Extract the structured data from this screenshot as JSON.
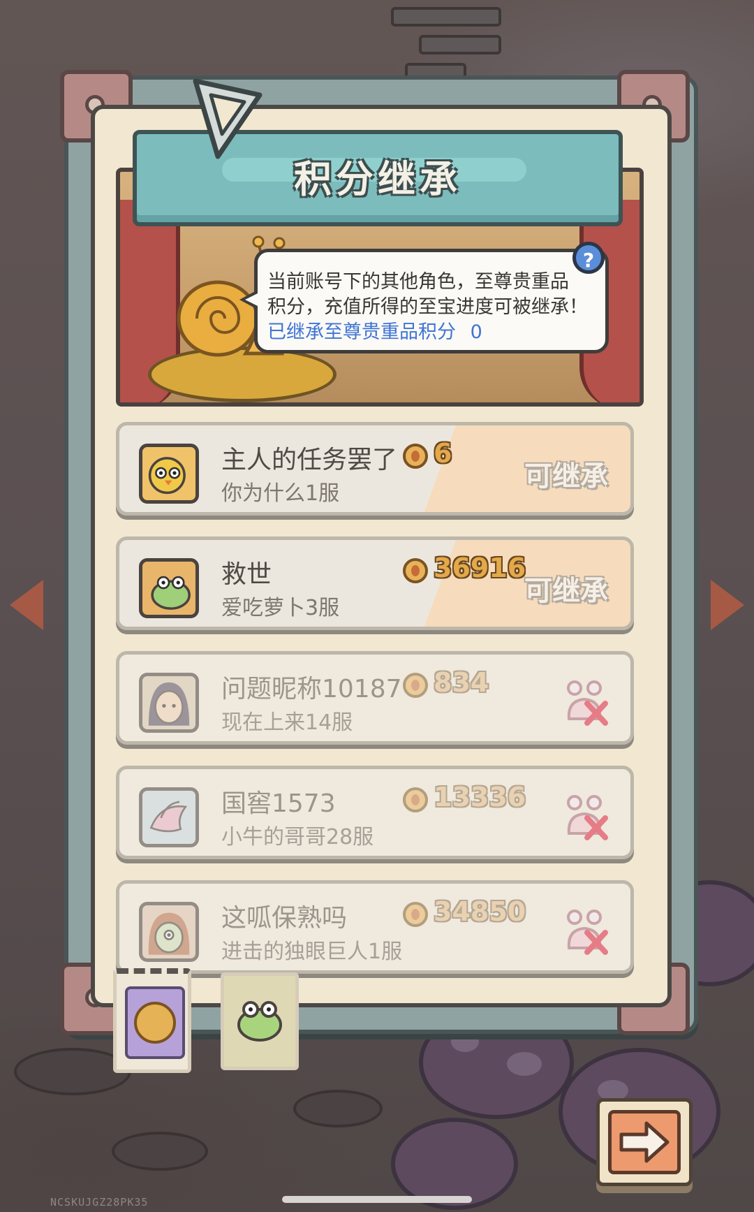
{
  "title": "积分继承",
  "info": {
    "line1": "当前账号下的其他角色，至尊贵重品",
    "line2": "积分，充值所得的至宝进度可被继承！",
    "inherited_label": "已继承至尊贵重品积分",
    "inherited_value": "0",
    "help_glyph": "?"
  },
  "characters": [
    {
      "name": "主人的任务罢了",
      "server": "你为什么1服",
      "score": "6",
      "status": "可继承",
      "inheritable": true,
      "avatar_icon": "chick-icon"
    },
    {
      "name": "救世",
      "server": "爱吃萝卜3服",
      "score": "36916",
      "status": "可继承",
      "inheritable": true,
      "avatar_icon": "frog-icon"
    },
    {
      "name": "问题昵称10187",
      "server": "现在上来14服",
      "score": "834",
      "status": "",
      "inheritable": false,
      "avatar_icon": "girl-icon"
    },
    {
      "name": "国窖1573",
      "server": "小牛的哥哥28服",
      "score": "13336",
      "status": "",
      "inheritable": false,
      "avatar_icon": "bird-icon"
    },
    {
      "name": "这呱保熟吗",
      "server": "进击的独眼巨人1服",
      "score": "34850",
      "status": "",
      "inheritable": false,
      "avatar_icon": "cyclops-icon"
    }
  ],
  "tabs": [
    {
      "icon": "coin-icon",
      "selected": true
    },
    {
      "icon": "frog-icon",
      "selected": false
    }
  ],
  "device_id": "NCSKUJGZ28PK35",
  "colors": {
    "banner": "#7cbcbd",
    "panel": "#f2e7d1",
    "link": "#3f74d6",
    "score": "#e3a94a"
  }
}
